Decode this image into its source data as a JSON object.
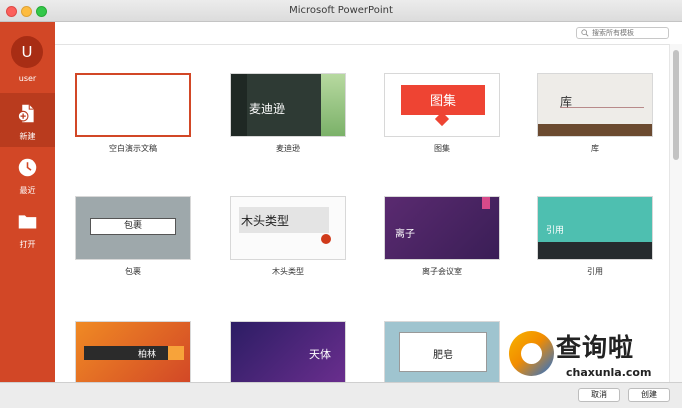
{
  "window": {
    "title": "Microsoft PowerPoint"
  },
  "sidebar": {
    "avatar_letter": "U",
    "user_label": "user",
    "items": [
      {
        "label": "新建",
        "icon": "new-file-icon",
        "active": true
      },
      {
        "label": "最近",
        "icon": "clock-icon",
        "active": false
      },
      {
        "label": "打开",
        "icon": "folder-icon",
        "active": false
      }
    ]
  },
  "search": {
    "placeholder": "搜索所有模板"
  },
  "templates": [
    {
      "name": "空白演示文稿",
      "thumb_text": ""
    },
    {
      "name": "麦迪逊",
      "thumb_text": "麦迪逊"
    },
    {
      "name": "图集",
      "thumb_text": "图集"
    },
    {
      "name": "库",
      "thumb_text": "库"
    },
    {
      "name": "包裹",
      "thumb_text": "包裹"
    },
    {
      "name": "木头类型",
      "thumb_text": "木头类型"
    },
    {
      "name": "离子会议室",
      "thumb_text": "离子"
    },
    {
      "name": "引用",
      "thumb_text": "引用"
    },
    {
      "name": "",
      "thumb_text": "柏林"
    },
    {
      "name": "",
      "thumb_text": "天体"
    },
    {
      "name": "",
      "thumb_text": "肥皂"
    }
  ],
  "footer": {
    "cancel_label": "取消",
    "create_label": "创建"
  },
  "watermark": {
    "text": "查询啦",
    "url": "chaxunla.com"
  },
  "colors": {
    "accent": "#d24726",
    "accent_dark": "#b93b1e"
  }
}
